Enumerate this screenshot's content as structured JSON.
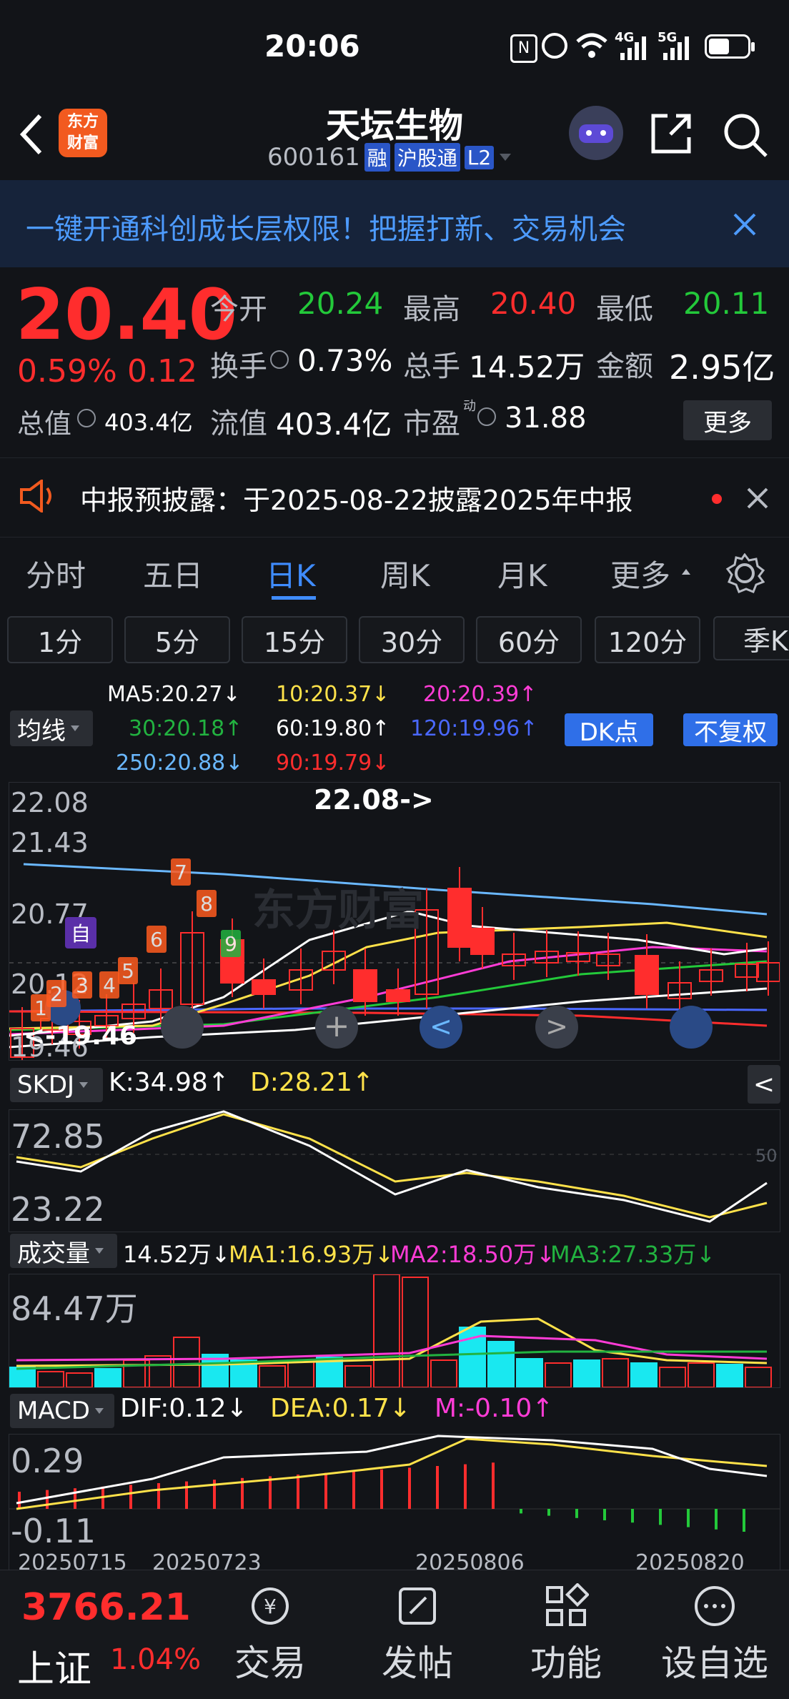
{
  "status_bar": {
    "time": "20:06",
    "network1": "4G",
    "network2": "5G"
  },
  "header": {
    "logo": "东方\n财富",
    "stock_name": "天坛生物",
    "stock_code": "600161",
    "tags": [
      "融",
      "沪股通",
      "L2"
    ]
  },
  "banner": {
    "text": "一键开通科创成长层权限！把握打新、交易机会"
  },
  "quote": {
    "price": "20.40",
    "change_pct": "0.59%",
    "change_abs": "0.12",
    "open_label": "今开",
    "open": "20.24",
    "high_label": "最高",
    "high": "20.40",
    "low_label": "最低",
    "low": "20.11",
    "turnover_label": "换手",
    "turnover": "0.73%",
    "volume_label": "总手",
    "volume": "14.52万",
    "amount_label": "金额",
    "amount": "2.95亿",
    "mktcap_label": "总值",
    "mktcap": "403.4亿",
    "float_label": "流值",
    "float": "403.4亿",
    "pe_label": "市盈",
    "pe_sup": "动",
    "pe": "31.88",
    "more_button": "更多"
  },
  "notice": {
    "text": "中报预披露：于2025-08-22披露2025年中报"
  },
  "tabs": [
    "分时",
    "五日",
    "日K",
    "周K",
    "月K",
    "更多"
  ],
  "active_tab": "日K",
  "periods": [
    "1分",
    "5分",
    "15分",
    "30分",
    "60分",
    "120分",
    "季K"
  ],
  "ma_panel": {
    "selector": "均线",
    "ma5": "MA5:20.27↓",
    "ma10": "10:20.37↓",
    "ma20": "20:20.39↑",
    "ma30": "30:20.18↑",
    "ma60": "60:19.80↑",
    "ma120": "120:19.96↑",
    "ma250": "250:20.88↓",
    "ma90": "90:19.79↓",
    "dk_button": "DK点",
    "fq_button": "不复权"
  },
  "kline": {
    "y_labels": [
      "22.08",
      "21.43",
      "20.77",
      "20.12",
      "19.46"
    ],
    "high_marker": "22.08->",
    "low_marker": "<-19.46",
    "signal_marker": "自",
    "watermark": "东方财富",
    "seq_labels": [
      "1",
      "2",
      "3",
      "4",
      "5",
      "6",
      "7",
      "8",
      "9"
    ]
  },
  "skdj": {
    "selector": "SKDJ",
    "k": "K:34.98↑",
    "d": "D:28.21↑",
    "y_high": "72.85",
    "y_low": "23.22",
    "ref": "50"
  },
  "volume": {
    "selector": "成交量",
    "vol": "14.52万↓",
    "ma1": "MA1:16.93万↓",
    "ma2": "MA2:18.50万↓",
    "ma3": "MA3:27.33万↓",
    "y_high": "84.47万"
  },
  "macd": {
    "selector": "MACD",
    "dif": "DIF:0.12↓",
    "dea": "DEA:0.17↓",
    "m": "M:-0.10↑",
    "y_high": "0.29",
    "y_low": "-0.11",
    "dates": [
      "20250715",
      "20250723",
      "20250806",
      "20250820"
    ]
  },
  "bottom": {
    "index_value": "3766.21",
    "index_name": "上证",
    "index_change": "1.04%",
    "nav": [
      "交易",
      "发帖",
      "功能",
      "设自选"
    ]
  },
  "colors": {
    "up": "#ff2d2d",
    "down": "#23c93a",
    "accent": "#2f6fe8",
    "bg": "#121418"
  }
}
